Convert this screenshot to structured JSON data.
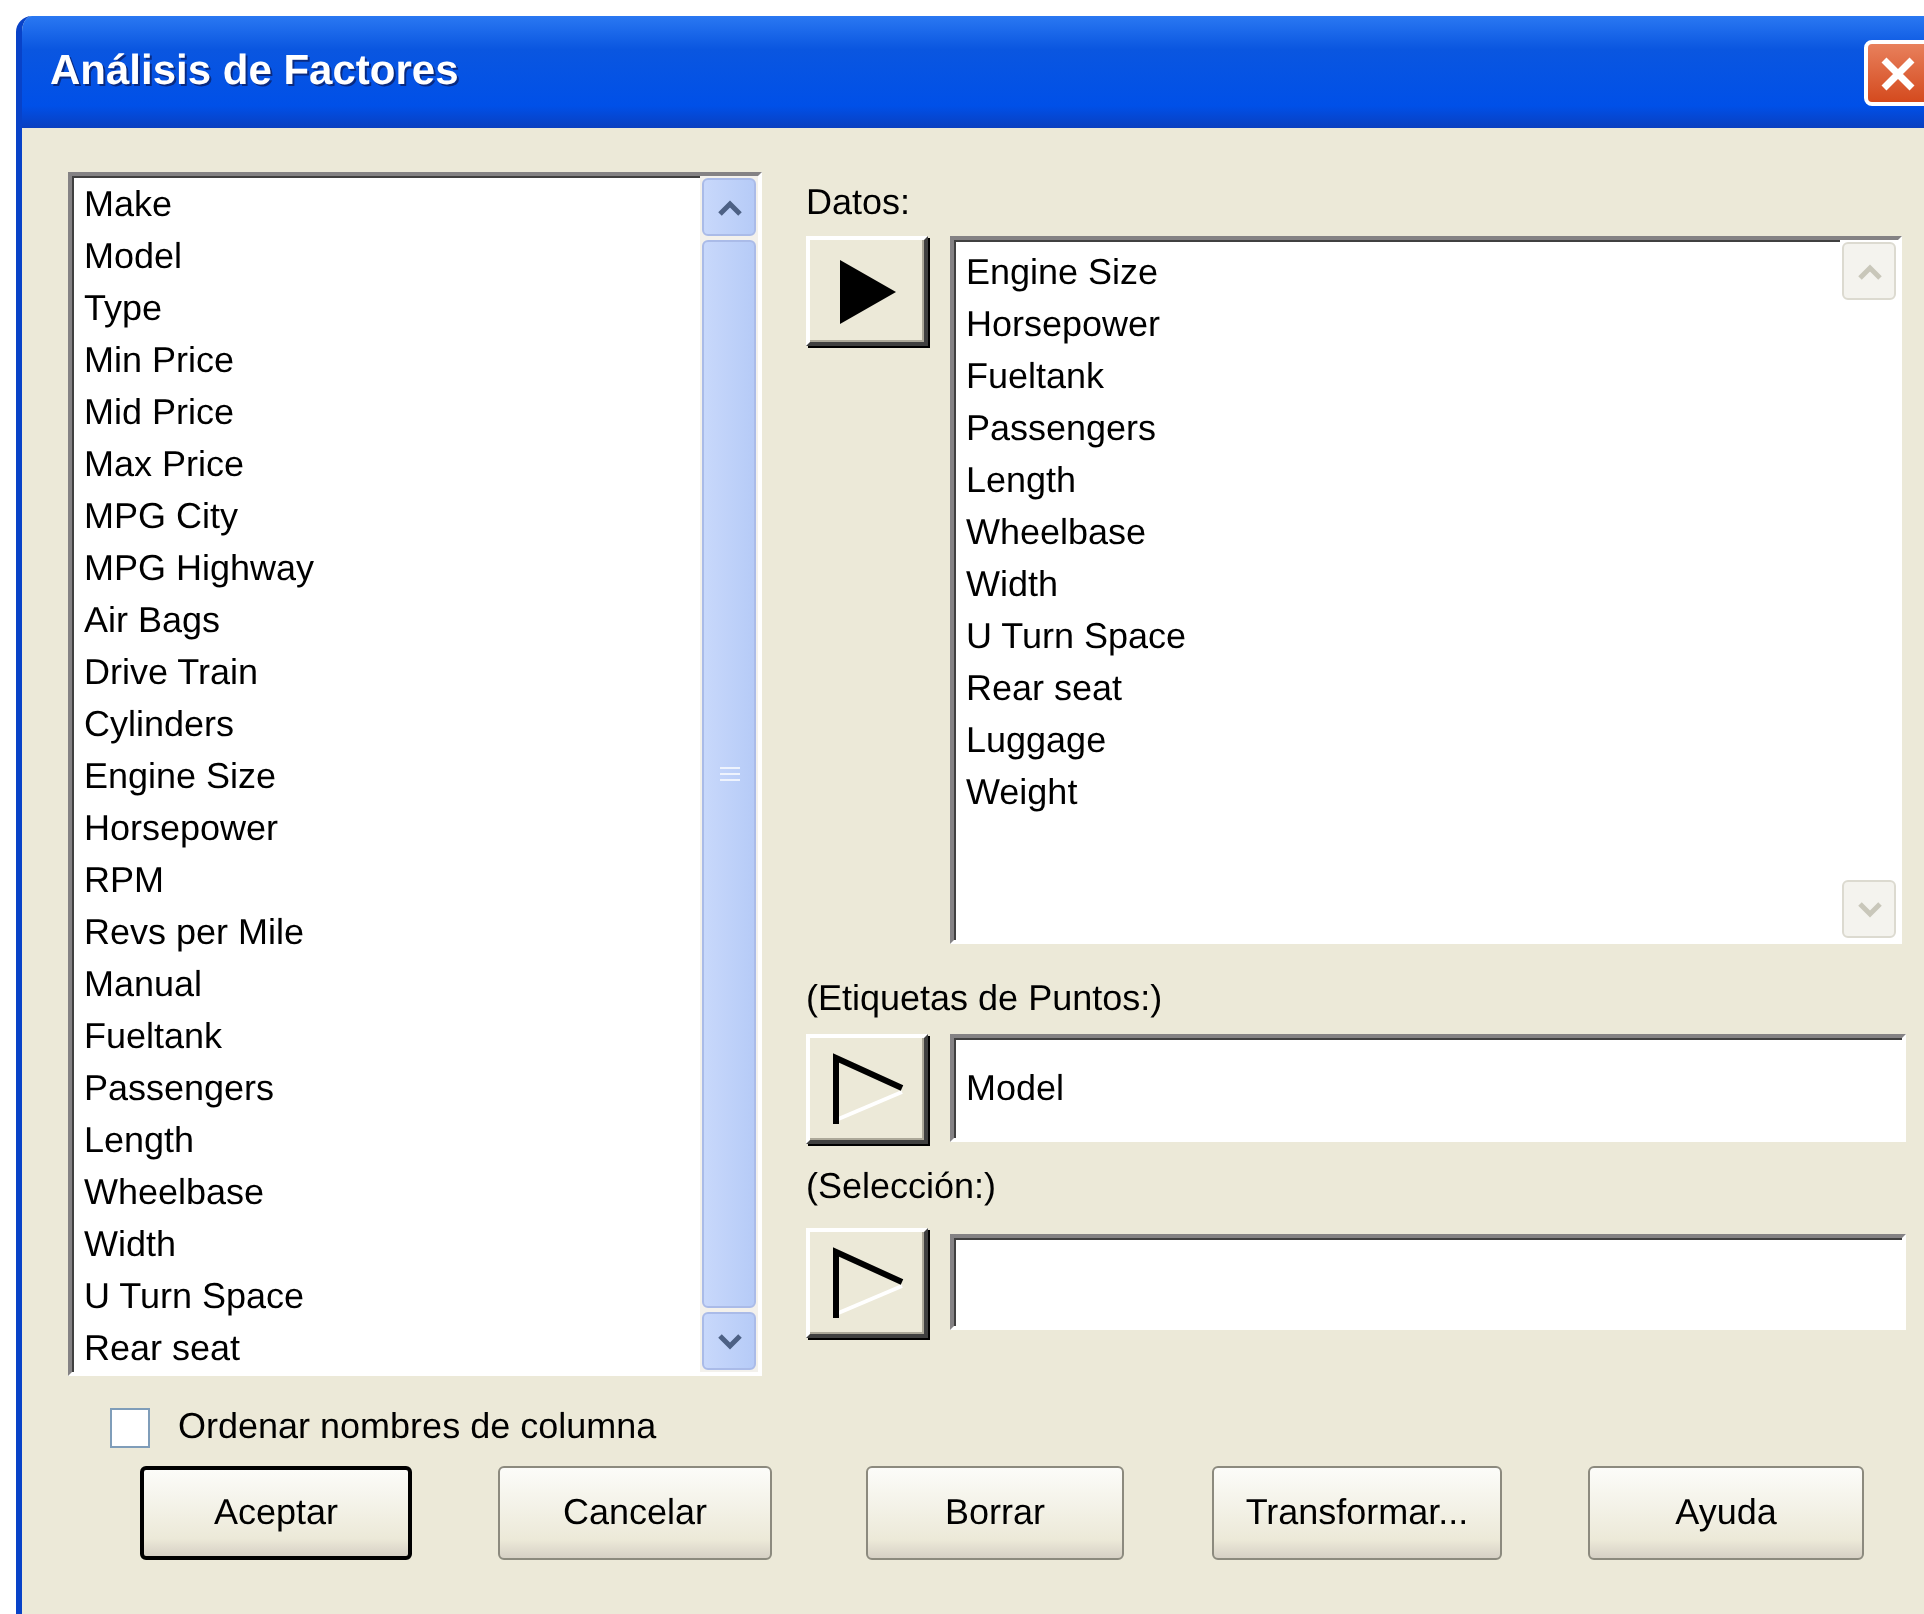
{
  "window": {
    "title": "Análisis de Factores"
  },
  "columns_list": {
    "items": [
      "Make",
      "Model",
      "Type",
      "Min Price",
      "Mid Price",
      "Max Price",
      "MPG City",
      "MPG Highway",
      "Air Bags",
      "Drive Train",
      "Cylinders",
      "Engine Size",
      "Horsepower",
      "RPM",
      "Revs per Mile",
      "Manual",
      "Fueltank",
      "Passengers",
      "Length",
      "Wheelbase",
      "Width",
      "U Turn Space",
      "Rear seat"
    ]
  },
  "datos": {
    "label": "Datos:",
    "active": true,
    "items": [
      "Engine Size",
      "Horsepower",
      "Fueltank",
      "Passengers",
      "Length",
      "Wheelbase",
      "Width",
      "U Turn Space",
      "Rear seat",
      "Luggage",
      "Weight"
    ]
  },
  "point_labels": {
    "label": "(Etiquetas de Puntos:)",
    "active": false,
    "value": "Model"
  },
  "selection": {
    "label": "(Selección:)",
    "active": false
  },
  "sort_checkbox": {
    "label": "Ordenar nombres de columna",
    "checked": false
  },
  "buttons": [
    {
      "label": "Aceptar",
      "default": true
    },
    {
      "label": "Cancelar",
      "default": false
    },
    {
      "label": "Borrar",
      "default": false
    },
    {
      "label": "Transformar...",
      "default": false
    },
    {
      "label": "Ayuda",
      "default": false
    }
  ]
}
